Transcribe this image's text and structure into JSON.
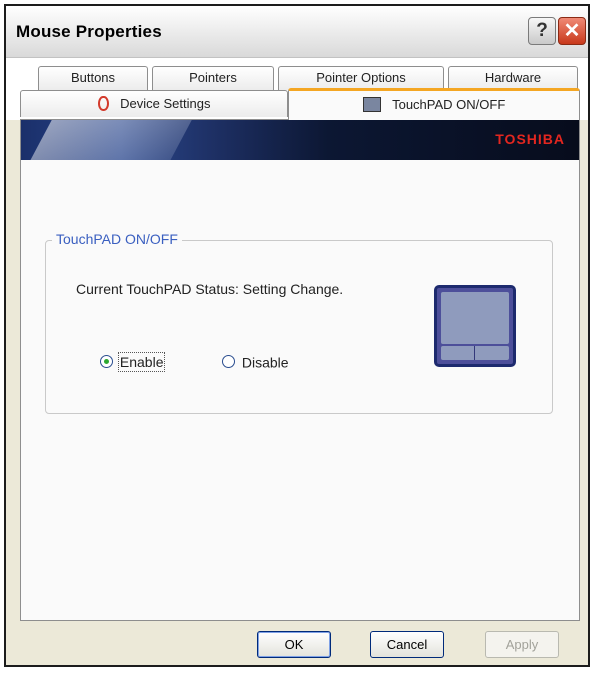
{
  "window": {
    "title": "Mouse Properties",
    "help_glyph": "?",
    "close_glyph": "✕"
  },
  "tabs": {
    "row1": [
      {
        "label": "Buttons"
      },
      {
        "label": "Pointers"
      },
      {
        "label": "Pointer Options"
      },
      {
        "label": "Hardware"
      }
    ],
    "row2": [
      {
        "label": "Device Settings",
        "icon": "mouse-icon"
      },
      {
        "label": "TouchPAD ON/OFF",
        "icon": "touchpad-icon",
        "active": true
      }
    ]
  },
  "banner": {
    "brand": "TOSHIBA",
    "brand_color": "#e3261f"
  },
  "group": {
    "legend": "TouchPAD ON/OFF",
    "status_text": "Current TouchPAD Status: Setting Change.",
    "options": [
      {
        "label": "Enable",
        "selected": true
      },
      {
        "label": "Disable",
        "selected": false
      }
    ]
  },
  "footer": {
    "ok_label": "OK",
    "cancel_label": "Cancel",
    "apply_label": "Apply",
    "apply_enabled": false
  },
  "colors": {
    "accent_tab": "#f4a623",
    "legend_text": "#3a5fc0",
    "radio_selected": "#2da830"
  }
}
